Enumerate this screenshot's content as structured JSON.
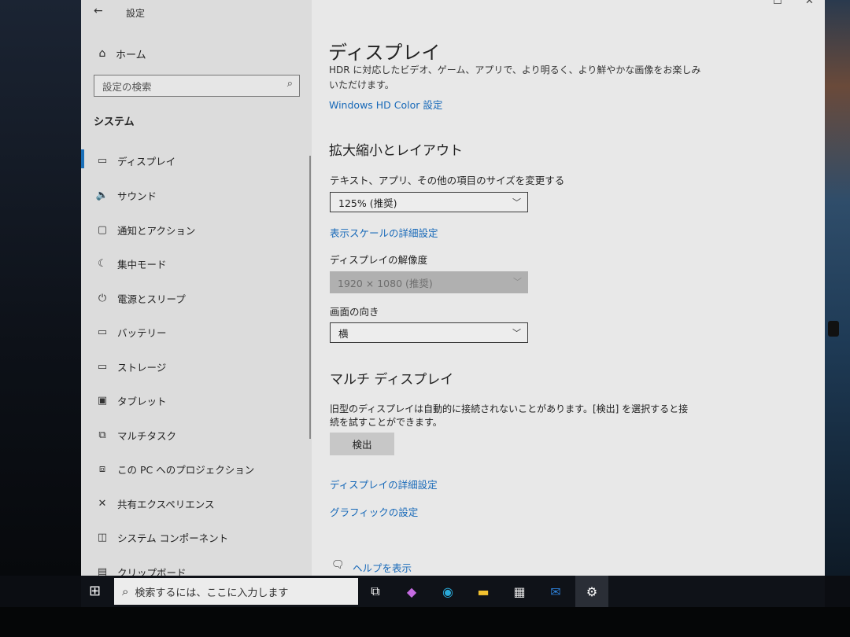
{
  "window": {
    "title": "設定",
    "back_icon": "back-arrow-icon",
    "controls": {
      "minimize": "—",
      "maximize": "☐",
      "close": "✕"
    }
  },
  "sidebar": {
    "home_label": "ホーム",
    "search_placeholder": "設定の検索",
    "section_title": "システム",
    "items": [
      {
        "label": "ディスプレイ",
        "icon": "monitor-icon",
        "glyph": "▭"
      },
      {
        "label": "サウンド",
        "icon": "speaker-icon",
        "glyph": "🔈"
      },
      {
        "label": "通知とアクション",
        "icon": "notification-icon",
        "glyph": "▢"
      },
      {
        "label": "集中モード",
        "icon": "moon-icon",
        "glyph": "☾"
      },
      {
        "label": "電源とスリープ",
        "icon": "power-icon",
        "glyph": "⏻"
      },
      {
        "label": "バッテリー",
        "icon": "battery-icon",
        "glyph": "▭"
      },
      {
        "label": "ストレージ",
        "icon": "storage-icon",
        "glyph": "▭"
      },
      {
        "label": "タブレット",
        "icon": "tablet-icon",
        "glyph": "▣"
      },
      {
        "label": "マルチタスク",
        "icon": "multitask-icon",
        "glyph": "⧉"
      },
      {
        "label": "この PC へのプロジェクション",
        "icon": "projection-icon",
        "glyph": "⧈"
      },
      {
        "label": "共有エクスペリエンス",
        "icon": "share-icon",
        "glyph": "✕"
      },
      {
        "label": "システム コンポーネント",
        "icon": "components-icon",
        "glyph": "◫"
      },
      {
        "label": "クリップボード",
        "icon": "clipboard-icon",
        "glyph": "▤"
      }
    ]
  },
  "main": {
    "page_title": "ディスプレイ",
    "hdr_desc_line1": "HDR に対応したビデオ、ゲーム、アプリで、より明るく、より鮮やかな画像をお楽しみ",
    "hdr_desc_line2": "いただけます。",
    "hdr_link": "Windows HD Color 設定",
    "scale_section": "拡大縮小とレイアウト",
    "scale_label": "テキスト、アプリ、その他の項目のサイズを変更する",
    "scale_value": "125% (推奨)",
    "scale_link": "表示スケールの詳細設定",
    "resolution_label": "ディスプレイの解像度",
    "resolution_value": "1920 × 1080 (推奨)",
    "orientation_label": "画面の向き",
    "orientation_value": "横",
    "multi_section": "マルチ ディスプレイ",
    "multi_desc_line1": "旧型のディスプレイは自動的に接続されないことがあります。[検出] を選択すると接",
    "multi_desc_line2": "続を試すことができます。",
    "detect_button": "検出",
    "advanced_link": "ディスプレイの詳細設定",
    "graphics_link": "グラフィックの設定",
    "help_link": "ヘルプを表示"
  },
  "taskbar": {
    "search_placeholder": "検索するには、ここに入力します",
    "pinned": [
      {
        "name": "task-view-icon",
        "glyph": "⧉",
        "color": "#ffffff"
      },
      {
        "name": "copilot-icon",
        "glyph": "◆",
        "color": "#c46ae0"
      },
      {
        "name": "edge-icon",
        "glyph": "◉",
        "color": "#2aa9d8"
      },
      {
        "name": "file-explorer-icon",
        "glyph": "▬",
        "color": "#f2c230"
      },
      {
        "name": "store-icon",
        "glyph": "▦",
        "color": "#e8e8e8"
      },
      {
        "name": "outlook-icon",
        "glyph": "✉",
        "color": "#2d7fd6"
      },
      {
        "name": "settings-icon",
        "glyph": "⚙",
        "color": "#ffffff"
      }
    ]
  }
}
